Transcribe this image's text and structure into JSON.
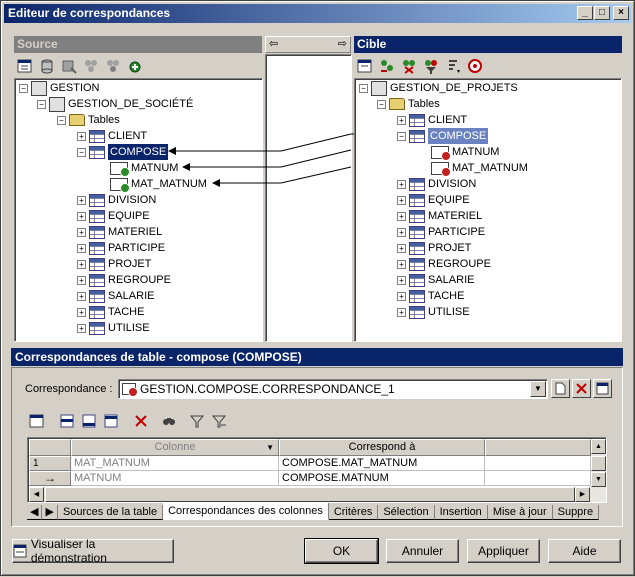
{
  "window": {
    "title": "Editeur de correspondances",
    "controls": {
      "minimize": "_",
      "maximize": "□",
      "close": "×"
    }
  },
  "source_panel": {
    "header": "Source",
    "tree": {
      "root": "GESTION",
      "model": "GESTION_DE_SOCIÉTÉ",
      "folder": "Tables",
      "tables": [
        "CLIENT",
        "COMPOSE",
        "DIVISION",
        "EQUIPE",
        "MATERIEL",
        "PARTICIPE",
        "PROJET",
        "REGROUPE",
        "SALARIE",
        "TACHE",
        "UTILISE"
      ],
      "compose_columns": [
        "MATNUM",
        "MAT_MATNUM"
      ]
    }
  },
  "target_panel": {
    "header": "Cible",
    "tree": {
      "root": "GESTION_DE_PROJETS",
      "folder": "Tables",
      "tables": [
        "CLIENT",
        "COMPOSE",
        "DIVISION",
        "EQUIPE",
        "MATERIEL",
        "PARTICIPE",
        "PROJET",
        "REGROUPE",
        "SALARIE",
        "TACHE",
        "UTILISE"
      ],
      "compose_columns": [
        "MATNUM",
        "MAT_MATNUM"
      ]
    }
  },
  "link_panel": {
    "left_arrow": "⇦",
    "right_arrow": "⇨"
  },
  "details": {
    "header": "Correspondances de table - compose (COMPOSE)",
    "correspondence_label": "Correspondance :",
    "correspondence_value": "GESTION.COMPOSE.CORRESPONDANCE_1",
    "grid": {
      "columns": [
        "Colonne",
        "Correspond à"
      ],
      "rows": [
        {
          "num": "1",
          "colonne": "MAT_MATNUM",
          "correspond": "COMPOSE.MAT_MATNUM"
        },
        {
          "num": "→",
          "colonne": "MATNUM",
          "correspond": "COMPOSE.MATNUM"
        }
      ]
    },
    "tabs": [
      "Sources de la table",
      "Correspondances des colonnes",
      "Critères",
      "Sélection",
      "Insertion",
      "Mise à jour",
      "Suppre"
    ],
    "active_tab": "Correspondances des colonnes"
  },
  "buttons": {
    "demo": "Visualiser la démonstration",
    "ok": "OK",
    "cancel": "Annuler",
    "apply": "Appliquer",
    "help": "Aide"
  },
  "colors": {
    "selection": "#0a246a",
    "title_gradient_start": "#0a246a",
    "face": "#d4d0c8"
  }
}
